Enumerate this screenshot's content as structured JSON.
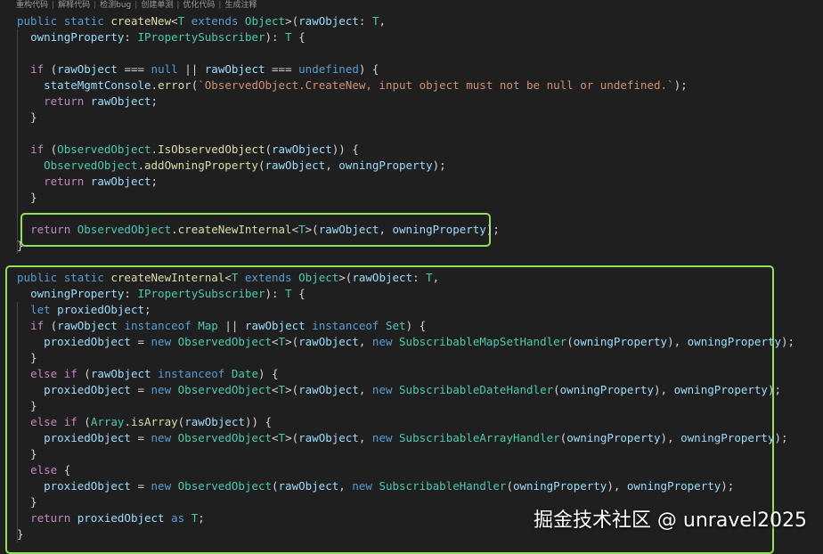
{
  "toolbar": {
    "items": [
      "重构代码",
      "解释代码",
      "检测bug",
      "创建单测",
      "优化代码",
      "生成注释"
    ]
  },
  "code_lines": [
    [
      [
        "kw",
        "public "
      ],
      [
        "kw",
        "static "
      ],
      [
        "fn",
        "createNew"
      ],
      [
        "pn",
        "<"
      ],
      [
        "ty",
        "T "
      ],
      [
        "kw",
        "extends "
      ],
      [
        "ty",
        "Object"
      ],
      [
        "pn",
        ">("
      ],
      [
        "vr",
        "rawObject"
      ],
      [
        "pn",
        ": "
      ],
      [
        "ty",
        "T"
      ],
      [
        "pn",
        ","
      ]
    ],
    [
      [
        "pn",
        "  "
      ],
      [
        "vr",
        "owningProperty"
      ],
      [
        "pn",
        ": "
      ],
      [
        "ty",
        "IPropertySubscriber"
      ],
      [
        "pn",
        "): "
      ],
      [
        "ty",
        "T "
      ],
      [
        "pn",
        "{"
      ]
    ],
    [],
    [
      [
        "pn",
        "  "
      ],
      [
        "ctl",
        "if "
      ],
      [
        "pn",
        "("
      ],
      [
        "vr",
        "rawObject "
      ],
      [
        "pn",
        "=== "
      ],
      [
        "kw",
        "null "
      ],
      [
        "pn",
        "|| "
      ],
      [
        "vr",
        "rawObject "
      ],
      [
        "pn",
        "=== "
      ],
      [
        "kw",
        "undefined"
      ],
      [
        "pn",
        ") {"
      ]
    ],
    [
      [
        "pn",
        "    "
      ],
      [
        "vr",
        "stateMgmtConsole"
      ],
      [
        "pn",
        "."
      ],
      [
        "fn",
        "error"
      ],
      [
        "pn",
        "("
      ],
      [
        "str",
        "`ObservedObject.CreateNew, input object must not be null or undefined.`"
      ],
      [
        "pn",
        ");"
      ]
    ],
    [
      [
        "pn",
        "    "
      ],
      [
        "ctl",
        "return "
      ],
      [
        "vr",
        "rawObject"
      ],
      [
        "pn",
        ";"
      ]
    ],
    [
      [
        "pn",
        "  }"
      ]
    ],
    [],
    [
      [
        "pn",
        "  "
      ],
      [
        "ctl",
        "if "
      ],
      [
        "pn",
        "("
      ],
      [
        "ty",
        "ObservedObject"
      ],
      [
        "pn",
        "."
      ],
      [
        "fn",
        "IsObservedObject"
      ],
      [
        "pn",
        "("
      ],
      [
        "vr",
        "rawObject"
      ],
      [
        "pn",
        ")) {"
      ]
    ],
    [
      [
        "pn",
        "    "
      ],
      [
        "ty",
        "ObservedObject"
      ],
      [
        "pn",
        "."
      ],
      [
        "fn",
        "addOwningProperty"
      ],
      [
        "pn",
        "("
      ],
      [
        "vr",
        "rawObject"
      ],
      [
        "pn",
        ", "
      ],
      [
        "vr",
        "owningProperty"
      ],
      [
        "pn",
        ");"
      ]
    ],
    [
      [
        "pn",
        "    "
      ],
      [
        "ctl",
        "return "
      ],
      [
        "vr",
        "rawObject"
      ],
      [
        "pn",
        ";"
      ]
    ],
    [
      [
        "pn",
        "  }"
      ]
    ],
    [],
    [
      [
        "pn",
        "  "
      ],
      [
        "ctl",
        "return "
      ],
      [
        "ty",
        "ObservedObject"
      ],
      [
        "pn",
        "."
      ],
      [
        "fn",
        "createNewInternal"
      ],
      [
        "pn",
        "<"
      ],
      [
        "ty",
        "T"
      ],
      [
        "pn",
        ">("
      ],
      [
        "vr",
        "rawObject"
      ],
      [
        "pn",
        ", "
      ],
      [
        "vr",
        "owningProperty"
      ],
      [
        "pn",
        ");"
      ]
    ],
    [
      [
        "pn",
        "}"
      ]
    ],
    [],
    [
      [
        "kw",
        "public "
      ],
      [
        "kw",
        "static "
      ],
      [
        "fn",
        "createNewInternal"
      ],
      [
        "pn",
        "<"
      ],
      [
        "ty",
        "T "
      ],
      [
        "kw",
        "extends "
      ],
      [
        "ty",
        "Object"
      ],
      [
        "pn",
        ">("
      ],
      [
        "vr",
        "rawObject"
      ],
      [
        "pn",
        ": "
      ],
      [
        "ty",
        "T"
      ],
      [
        "pn",
        ","
      ]
    ],
    [
      [
        "pn",
        "  "
      ],
      [
        "vr",
        "owningProperty"
      ],
      [
        "pn",
        ": "
      ],
      [
        "ty",
        "IPropertySubscriber"
      ],
      [
        "pn",
        "): "
      ],
      [
        "ty",
        "T "
      ],
      [
        "pn",
        "{"
      ]
    ],
    [
      [
        "pn",
        "  "
      ],
      [
        "kw",
        "let "
      ],
      [
        "vr",
        "proxiedObject"
      ],
      [
        "pn",
        ";"
      ]
    ],
    [
      [
        "pn",
        "  "
      ],
      [
        "ctl",
        "if "
      ],
      [
        "pn",
        "("
      ],
      [
        "vr",
        "rawObject "
      ],
      [
        "kw",
        "instanceof "
      ],
      [
        "ty",
        "Map "
      ],
      [
        "pn",
        "|| "
      ],
      [
        "vr",
        "rawObject "
      ],
      [
        "kw",
        "instanceof "
      ],
      [
        "ty",
        "Set"
      ],
      [
        "pn",
        ") {"
      ]
    ],
    [
      [
        "pn",
        "    "
      ],
      [
        "vr",
        "proxiedObject "
      ],
      [
        "pn",
        "= "
      ],
      [
        "kw",
        "new "
      ],
      [
        "ty",
        "ObservedObject"
      ],
      [
        "pn",
        "<"
      ],
      [
        "ty",
        "T"
      ],
      [
        "pn",
        ">("
      ],
      [
        "vr",
        "rawObject"
      ],
      [
        "pn",
        ", "
      ],
      [
        "kw",
        "new "
      ],
      [
        "ty",
        "SubscribableMapSetHandler"
      ],
      [
        "pn",
        "("
      ],
      [
        "vr",
        "owningProperty"
      ],
      [
        "pn",
        "), "
      ],
      [
        "vr",
        "owningProperty"
      ],
      [
        "pn",
        ");"
      ]
    ],
    [
      [
        "pn",
        "  }"
      ]
    ],
    [
      [
        "pn",
        "  "
      ],
      [
        "ctl",
        "else if "
      ],
      [
        "pn",
        "("
      ],
      [
        "vr",
        "rawObject "
      ],
      [
        "kw",
        "instanceof "
      ],
      [
        "ty",
        "Date"
      ],
      [
        "pn",
        ") {"
      ]
    ],
    [
      [
        "pn",
        "    "
      ],
      [
        "vr",
        "proxiedObject "
      ],
      [
        "pn",
        "= "
      ],
      [
        "kw",
        "new "
      ],
      [
        "ty",
        "ObservedObject"
      ],
      [
        "pn",
        "<"
      ],
      [
        "ty",
        "T"
      ],
      [
        "pn",
        ">("
      ],
      [
        "vr",
        "rawObject"
      ],
      [
        "pn",
        ", "
      ],
      [
        "kw",
        "new "
      ],
      [
        "ty",
        "SubscribableDateHandler"
      ],
      [
        "pn",
        "("
      ],
      [
        "vr",
        "owningProperty"
      ],
      [
        "pn",
        "), "
      ],
      [
        "vr",
        "owningProperty"
      ],
      [
        "pn",
        ");"
      ]
    ],
    [
      [
        "pn",
        "  }"
      ]
    ],
    [
      [
        "pn",
        "  "
      ],
      [
        "ctl",
        "else if "
      ],
      [
        "pn",
        "("
      ],
      [
        "ty",
        "Array"
      ],
      [
        "pn",
        "."
      ],
      [
        "fn",
        "isArray"
      ],
      [
        "pn",
        "("
      ],
      [
        "vr",
        "rawObject"
      ],
      [
        "pn",
        ")) {"
      ]
    ],
    [
      [
        "pn",
        "    "
      ],
      [
        "vr",
        "proxiedObject "
      ],
      [
        "pn",
        "= "
      ],
      [
        "kw",
        "new "
      ],
      [
        "ty",
        "ObservedObject"
      ],
      [
        "pn",
        "<"
      ],
      [
        "ty",
        "T"
      ],
      [
        "pn",
        ">("
      ],
      [
        "vr",
        "rawObject"
      ],
      [
        "pn",
        ", "
      ],
      [
        "kw",
        "new "
      ],
      [
        "ty",
        "SubscribableArrayHandler"
      ],
      [
        "pn",
        "("
      ],
      [
        "vr",
        "owningProperty"
      ],
      [
        "pn",
        "), "
      ],
      [
        "vr",
        "owningProperty"
      ],
      [
        "pn",
        ");"
      ]
    ],
    [
      [
        "pn",
        "  }"
      ]
    ],
    [
      [
        "pn",
        "  "
      ],
      [
        "ctl",
        "else "
      ],
      [
        "pn",
        "{"
      ]
    ],
    [
      [
        "pn",
        "    "
      ],
      [
        "vr",
        "proxiedObject "
      ],
      [
        "pn",
        "= "
      ],
      [
        "kw",
        "new "
      ],
      [
        "ty",
        "ObservedObject"
      ],
      [
        "pn",
        "("
      ],
      [
        "vr",
        "rawObject"
      ],
      [
        "pn",
        ", "
      ],
      [
        "kw",
        "new "
      ],
      [
        "ty",
        "SubscribableHandler"
      ],
      [
        "pn",
        "("
      ],
      [
        "vr",
        "owningProperty"
      ],
      [
        "pn",
        "), "
      ],
      [
        "vr",
        "owningProperty"
      ],
      [
        "pn",
        ");"
      ]
    ],
    [
      [
        "pn",
        "  }"
      ]
    ],
    [
      [
        "pn",
        "  "
      ],
      [
        "ctl",
        "return "
      ],
      [
        "vr",
        "proxiedObject "
      ],
      [
        "kw",
        "as "
      ],
      [
        "ty",
        "T"
      ],
      [
        "pn",
        ";"
      ]
    ],
    [
      [
        "pn",
        "}"
      ]
    ]
  ],
  "highlights": [
    {
      "label": "return-createNewInternal-line",
      "from_line": 13,
      "to_line": 13
    },
    {
      "label": "createNewInternal-method",
      "from_line": 16,
      "to_line": 32
    }
  ],
  "watermark": "掘金技术社区 @ unravel2025",
  "colors": {
    "background": "#1f1f1f",
    "keyword": "#569cd6",
    "type": "#4ec9b0",
    "function": "#dcdcaa",
    "variable": "#9cdcfe",
    "control": "#c586c0",
    "string": "#ce9178",
    "highlight_border": "#8fe05a"
  }
}
